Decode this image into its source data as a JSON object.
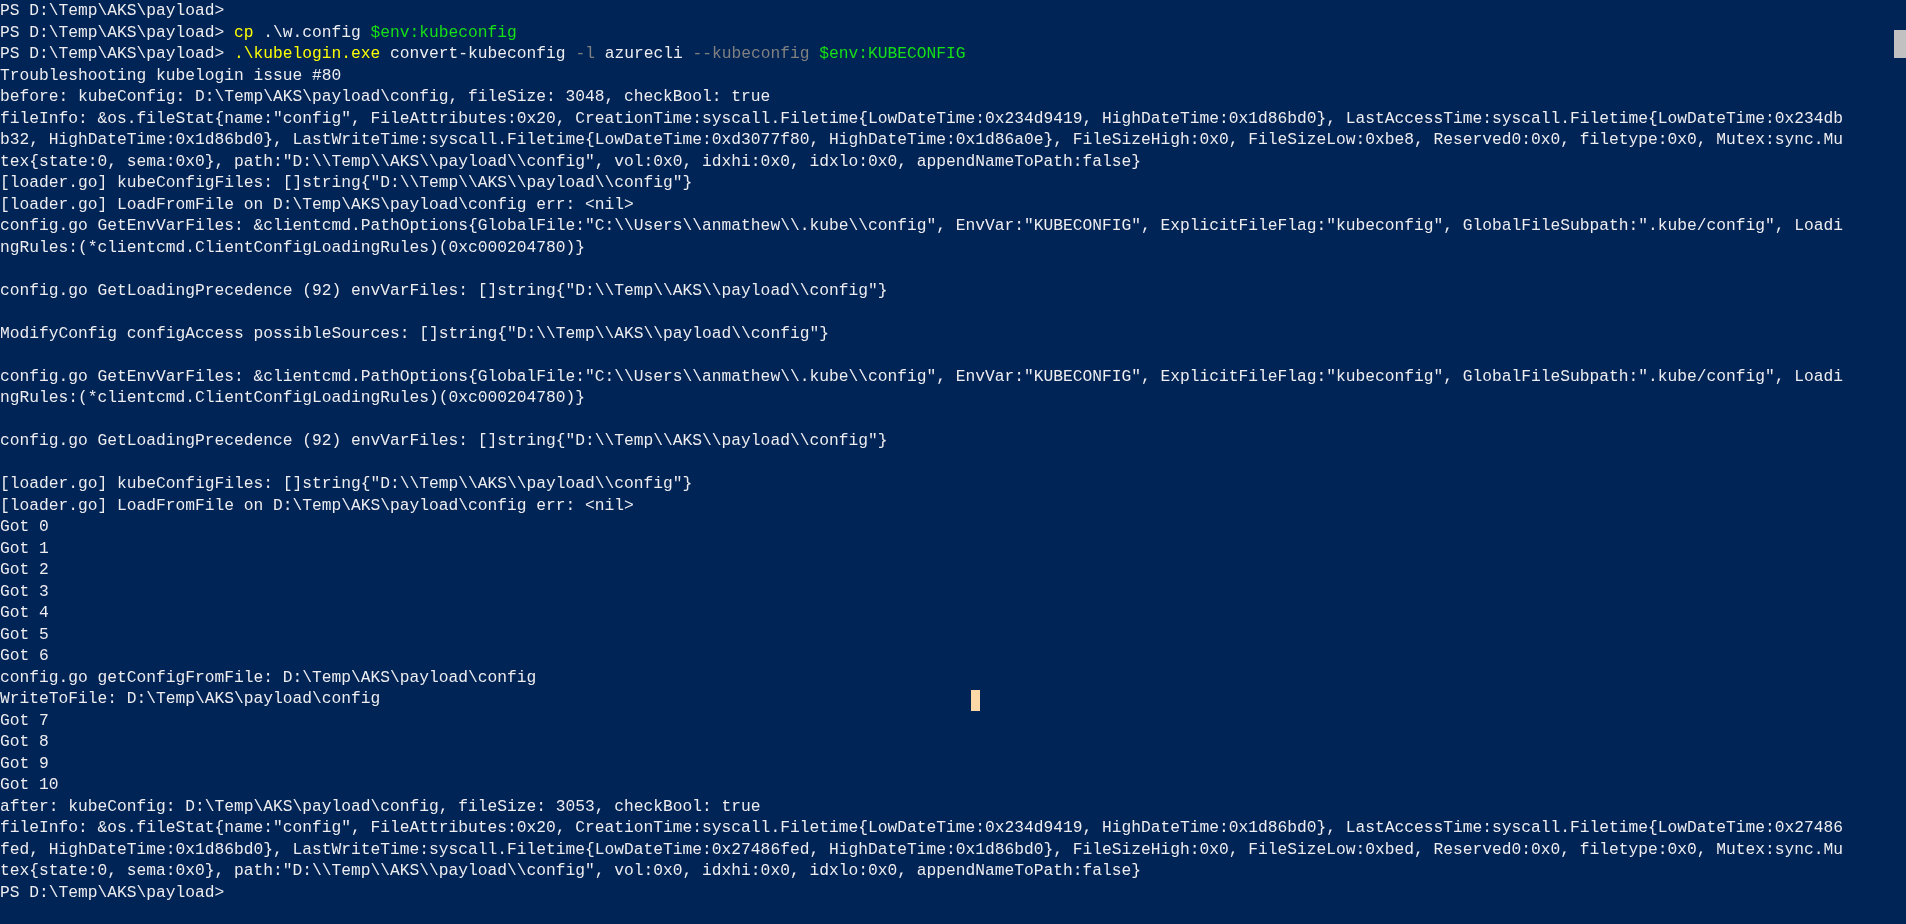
{
  "terminal": {
    "lines": [
      {
        "kind": "prompt",
        "segments": [
          {
            "kind": "prompt",
            "text": "PS D:\\Temp\\AKS\\payload>"
          }
        ]
      },
      {
        "kind": "prompt",
        "segments": [
          {
            "kind": "prompt",
            "text": "PS D:\\Temp\\AKS\\payload> "
          },
          {
            "kind": "command",
            "text": "cp"
          },
          {
            "kind": "plain",
            "text": " .\\w.config "
          },
          {
            "kind": "variable",
            "text": "$env:kubeconfig"
          }
        ]
      },
      {
        "kind": "prompt",
        "segments": [
          {
            "kind": "prompt",
            "text": "PS D:\\Temp\\AKS\\payload> "
          },
          {
            "kind": "command",
            "text": ".\\kubelogin.exe"
          },
          {
            "kind": "plain",
            "text": " convert-kubeconfig "
          },
          {
            "kind": "parameter",
            "text": "-l"
          },
          {
            "kind": "plain",
            "text": " azurecli "
          },
          {
            "kind": "parameter",
            "text": "--kubeconfig "
          },
          {
            "kind": "variable",
            "text": "$env:KUBECONFIG"
          }
        ]
      },
      {
        "kind": "output",
        "text": "Troubleshooting kubelogin issue #80"
      },
      {
        "kind": "output",
        "text": "before: kubeConfig: D:\\Temp\\AKS\\payload\\config, fileSize: 3048, checkBool: true"
      },
      {
        "kind": "output",
        "text": "fileInfo: &os.fileStat{name:\"config\", FileAttributes:0x20, CreationTime:syscall.Filetime{LowDateTime:0x234d9419, HighDateTime:0x1d86bd0}, LastAccessTime:syscall.Filetime{LowDateTime:0x234db"
      },
      {
        "kind": "output",
        "text": "b32, HighDateTime:0x1d86bd0}, LastWriteTime:syscall.Filetime{LowDateTime:0xd3077f80, HighDateTime:0x1d86a0e}, FileSizeHigh:0x0, FileSizeLow:0xbe8, Reserved0:0x0, filetype:0x0, Mutex:sync.Mu"
      },
      {
        "kind": "output",
        "text": "tex{state:0, sema:0x0}, path:\"D:\\\\Temp\\\\AKS\\\\payload\\\\config\", vol:0x0, idxhi:0x0, idxlo:0x0, appendNameToPath:false}"
      },
      {
        "kind": "output",
        "text": "[loader.go] kubeConfigFiles: []string{\"D:\\\\Temp\\\\AKS\\\\payload\\\\config\"}"
      },
      {
        "kind": "output",
        "text": "[loader.go] LoadFromFile on D:\\Temp\\AKS\\payload\\config err: <nil>"
      },
      {
        "kind": "output",
        "text": "config.go GetEnvVarFiles: &clientcmd.PathOptions{GlobalFile:\"C:\\\\Users\\\\anmathew\\\\.kube\\\\config\", EnvVar:\"KUBECONFIG\", ExplicitFileFlag:\"kubeconfig\", GlobalFileSubpath:\".kube/config\", Loadi"
      },
      {
        "kind": "output",
        "text": "ngRules:(*clientcmd.ClientConfigLoadingRules)(0xc000204780)}"
      },
      {
        "kind": "blank"
      },
      {
        "kind": "output",
        "text": "config.go GetLoadingPrecedence (92) envVarFiles: []string{\"D:\\\\Temp\\\\AKS\\\\payload\\\\config\"}"
      },
      {
        "kind": "blank"
      },
      {
        "kind": "output",
        "text": "ModifyConfig configAccess possibleSources: []string{\"D:\\\\Temp\\\\AKS\\\\payload\\\\config\"}"
      },
      {
        "kind": "blank"
      },
      {
        "kind": "output",
        "text": "config.go GetEnvVarFiles: &clientcmd.PathOptions{GlobalFile:\"C:\\\\Users\\\\anmathew\\\\.kube\\\\config\", EnvVar:\"KUBECONFIG\", ExplicitFileFlag:\"kubeconfig\", GlobalFileSubpath:\".kube/config\", Loadi"
      },
      {
        "kind": "output",
        "text": "ngRules:(*clientcmd.ClientConfigLoadingRules)(0xc000204780)}"
      },
      {
        "kind": "blank"
      },
      {
        "kind": "output",
        "text": "config.go GetLoadingPrecedence (92) envVarFiles: []string{\"D:\\\\Temp\\\\AKS\\\\payload\\\\config\"}"
      },
      {
        "kind": "blank"
      },
      {
        "kind": "output",
        "text": "[loader.go] kubeConfigFiles: []string{\"D:\\\\Temp\\\\AKS\\\\payload\\\\config\"}"
      },
      {
        "kind": "output",
        "text": "[loader.go] LoadFromFile on D:\\Temp\\AKS\\payload\\config err: <nil>"
      },
      {
        "kind": "output",
        "text": "Got 0"
      },
      {
        "kind": "output",
        "text": "Got 1"
      },
      {
        "kind": "output",
        "text": "Got 2"
      },
      {
        "kind": "output",
        "text": "Got 3"
      },
      {
        "kind": "output",
        "text": "Got 4"
      },
      {
        "kind": "output",
        "text": "Got 5"
      },
      {
        "kind": "output",
        "text": "Got 6"
      },
      {
        "kind": "output",
        "text": "config.go getConfigFromFile: D:\\Temp\\AKS\\payload\\config"
      },
      {
        "kind": "output",
        "text": "WriteToFile: D:\\Temp\\AKS\\payload\\config"
      },
      {
        "kind": "output",
        "text": "Got 7"
      },
      {
        "kind": "output",
        "text": "Got 8"
      },
      {
        "kind": "output",
        "text": "Got 9"
      },
      {
        "kind": "output",
        "text": "Got 10"
      },
      {
        "kind": "output",
        "text": "after: kubeConfig: D:\\Temp\\AKS\\payload\\config, fileSize: 3053, checkBool: true"
      },
      {
        "kind": "output",
        "text": "fileInfo: &os.fileStat{name:\"config\", FileAttributes:0x20, CreationTime:syscall.Filetime{LowDateTime:0x234d9419, HighDateTime:0x1d86bd0}, LastAccessTime:syscall.Filetime{LowDateTime:0x27486"
      },
      {
        "kind": "output",
        "text": "fed, HighDateTime:0x1d86bd0}, LastWriteTime:syscall.Filetime{LowDateTime:0x27486fed, HighDateTime:0x1d86bd0}, FileSizeHigh:0x0, FileSizeLow:0xbed, Reserved0:0x0, filetype:0x0, Mutex:sync.Mu"
      },
      {
        "kind": "output",
        "text": "tex{state:0, sema:0x0}, path:\"D:\\\\Temp\\\\AKS\\\\payload\\\\config\", vol:0x0, idxhi:0x0, idxlo:0x0, appendNameToPath:false}"
      },
      {
        "kind": "prompt",
        "segments": [
          {
            "kind": "prompt",
            "text": "PS D:\\Temp\\AKS\\payload>"
          }
        ]
      }
    ]
  }
}
